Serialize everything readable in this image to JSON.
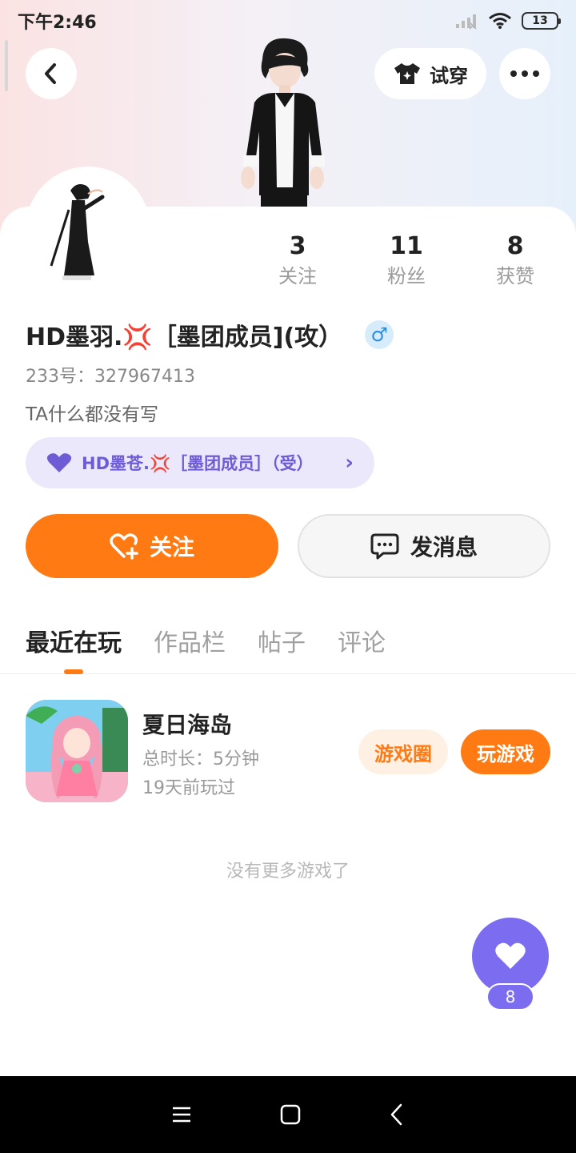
{
  "status_bar": {
    "time": "下午2:46",
    "battery": "13"
  },
  "header": {
    "tryon_label": "试穿"
  },
  "stats": [
    {
      "num": "3",
      "label": "关注"
    },
    {
      "num": "11",
      "label": "粉丝"
    },
    {
      "num": "8",
      "label": "获赞"
    }
  ],
  "profile": {
    "name": "HD墨羽.💢［墨团成员](攻）",
    "gender_symbol": "♂",
    "uid": "233号：327967413",
    "bio": "TA什么都没有写",
    "cp_label": "HD墨苍.💢［墨团成员］（受）"
  },
  "actions": {
    "follow_label": "关注",
    "message_label": "发消息"
  },
  "tabs": [
    "最近在玩",
    "作品栏",
    "帖子",
    "评论"
  ],
  "game": {
    "title": "夏日海岛",
    "duration": "总时长：5分钟",
    "last_played": "19天前玩过",
    "circle_label": "游戏圈",
    "play_label": "玩游戏"
  },
  "no_more_text": "没有更多游戏了",
  "likes": {
    "count": "8"
  },
  "colors": {
    "accent": "#ff7a12",
    "purple": "#7c6cf0",
    "cp_text": "#6e5bd6"
  }
}
